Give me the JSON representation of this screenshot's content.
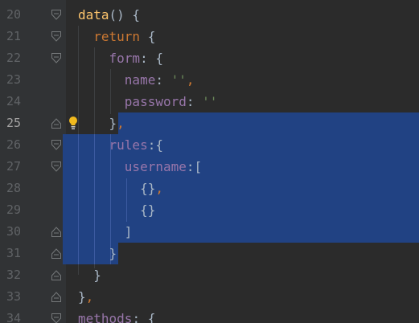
{
  "editor": {
    "line_numbers": [
      "20",
      "21",
      "22",
      "23",
      "24",
      "25",
      "26",
      "27",
      "28",
      "29",
      "30",
      "31",
      "32",
      "33",
      "34"
    ],
    "current_line": "25",
    "icons": {
      "fold_open": "fold-open-icon",
      "fold_close": "fold-close-icon",
      "intention": "lightbulb-icon"
    },
    "colors": {
      "background": "#2b2b2b",
      "gutter": "#313335",
      "selection": "#214283",
      "keyword": "#cc7832",
      "function": "#ffc66d",
      "property": "#9876aa",
      "string": "#6a8759",
      "text": "#a9b7c6",
      "line_number": "#606366",
      "lightbulb": "#f0b91e"
    },
    "code": {
      "l20": {
        "indent": "",
        "fn": "data",
        "rest": "() {"
      },
      "l21": {
        "indent": "  ",
        "kw": "return",
        "rest": " {"
      },
      "l22": {
        "indent": "    ",
        "prop": "form",
        "rest": ": {"
      },
      "l23": {
        "indent": "      ",
        "prop": "name",
        "colon": ": ",
        "str": "''",
        "comma": ","
      },
      "l24": {
        "indent": "      ",
        "prop": "password",
        "colon": ": ",
        "str": "''"
      },
      "l25": {
        "indent": "    ",
        "text": "}",
        "comma": ","
      },
      "l26": {
        "indent": "    ",
        "prop": "rules",
        "rest": ":{"
      },
      "l27": {
        "indent": "      ",
        "prop": "username",
        "rest": ":["
      },
      "l28": {
        "indent": "        ",
        "text": "{}",
        "comma": ","
      },
      "l29": {
        "indent": "        ",
        "text": "{}"
      },
      "l30": {
        "indent": "      ",
        "text": "]"
      },
      "l31": {
        "indent": "    ",
        "text": "}"
      },
      "l32": {
        "indent": "  ",
        "text": "}"
      },
      "l33": {
        "indent": "",
        "text": "}",
        "comma": ","
      },
      "l34": {
        "indent": "",
        "prop": "methods",
        "rest": ": {"
      }
    }
  }
}
